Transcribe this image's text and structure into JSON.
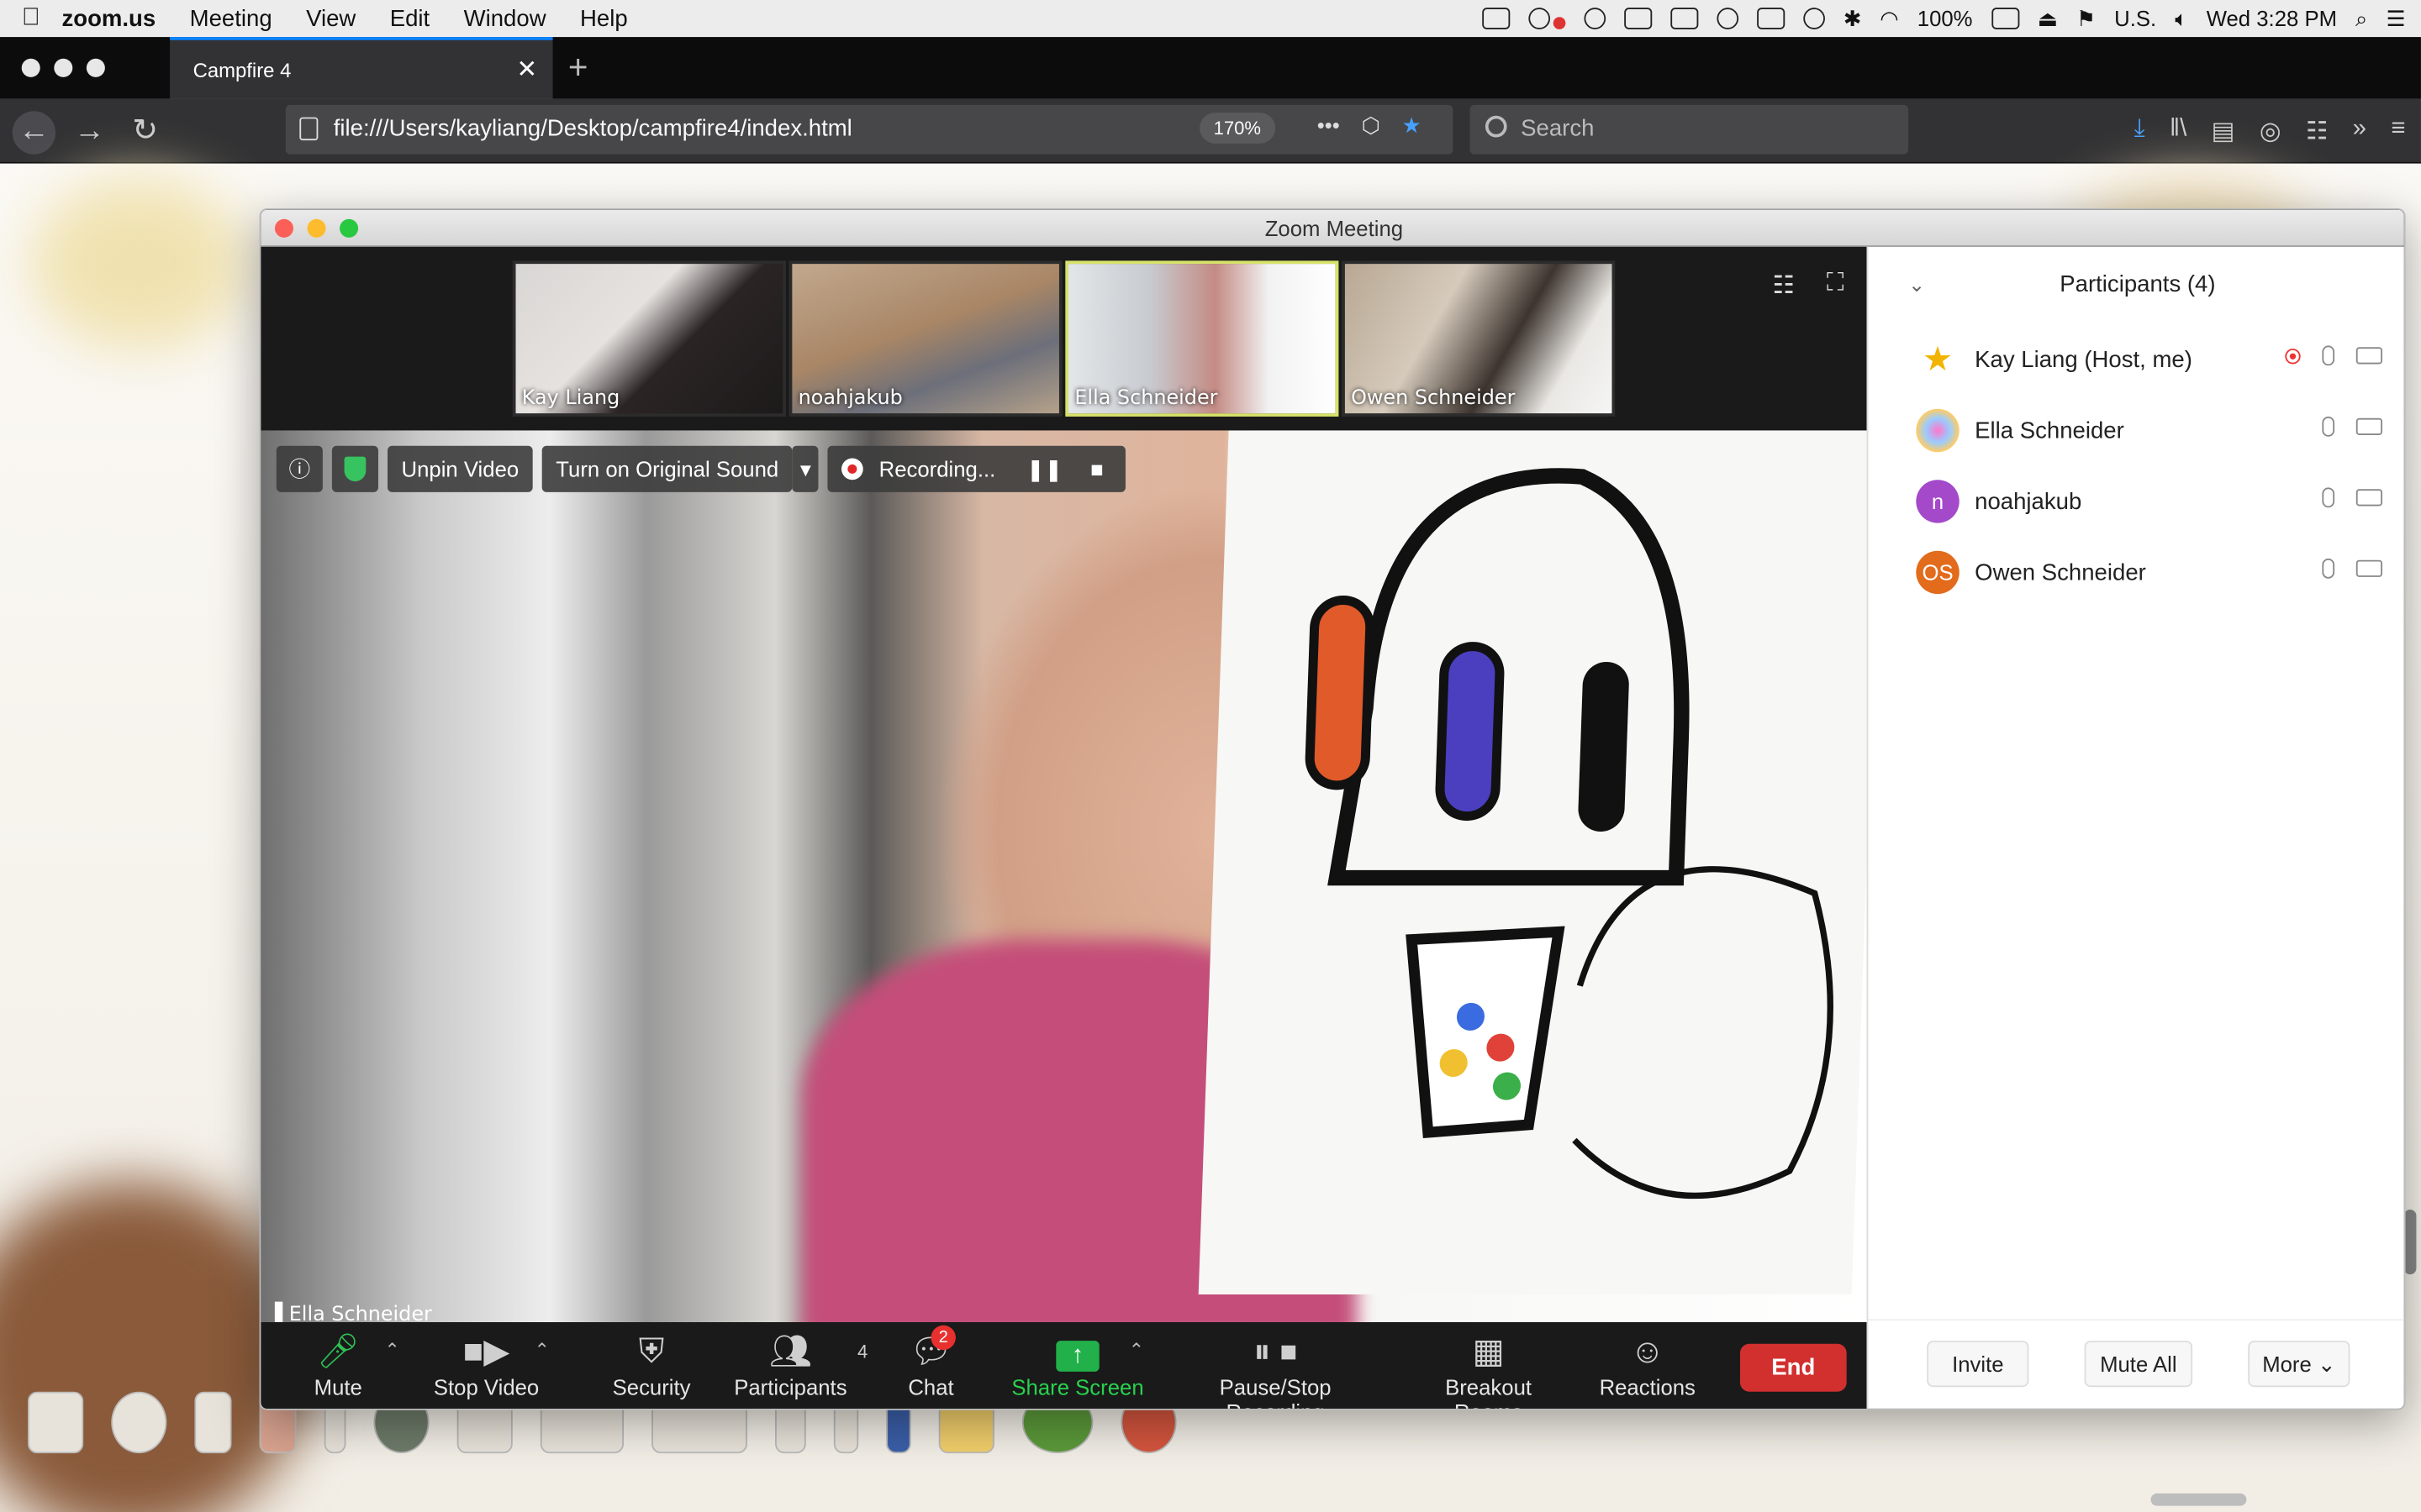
{
  "menubar": {
    "app": "zoom.us",
    "items": [
      "Meeting",
      "View",
      "Edit",
      "Window",
      "Help"
    ],
    "battery": "100%",
    "input_source": "U.S.",
    "clock": "Wed 3:28 PM"
  },
  "browser": {
    "tab_title": "Campfire 4",
    "url": "file:///Users/kayliang/Desktop/campfire4/index.html",
    "zoom_level": "170%",
    "search_placeholder": "Search"
  },
  "zoom": {
    "window_title": "Zoom Meeting",
    "thumbnails": [
      {
        "name": "Kay Liang"
      },
      {
        "name": "noahjakub"
      },
      {
        "name": "Ella Schneider"
      },
      {
        "name": "Owen Schneider"
      }
    ],
    "video_controls": {
      "unpin": "Unpin Video",
      "original_sound": "Turn on Original Sound",
      "recording": "Recording..."
    },
    "main_caption": "Ella Schneider",
    "toolbar": {
      "mute": "Mute",
      "stop_video": "Stop Video",
      "security": "Security",
      "participants": "Participants",
      "participants_count": "4",
      "chat": "Chat",
      "chat_badge": "2",
      "share_screen": "Share Screen",
      "recording": "Pause/Stop Recording",
      "breakout": "Breakout Rooms",
      "reactions": "Reactions",
      "end": "End"
    },
    "participants_panel": {
      "title": "Participants (4)",
      "people": [
        {
          "name": "Kay Liang (Host, me)",
          "avatar": "",
          "avatar_color": "#ffffff"
        },
        {
          "name": "Ella Schneider",
          "avatar": "",
          "avatar_color": "#f0c8c8"
        },
        {
          "name": "noahjakub",
          "avatar": "n",
          "avatar_color": "#a349c9"
        },
        {
          "name": "Owen Schneider",
          "avatar": "OS",
          "avatar_color": "#e26b1c"
        }
      ],
      "invite": "Invite",
      "mute_all": "Mute All",
      "more": "More"
    }
  }
}
